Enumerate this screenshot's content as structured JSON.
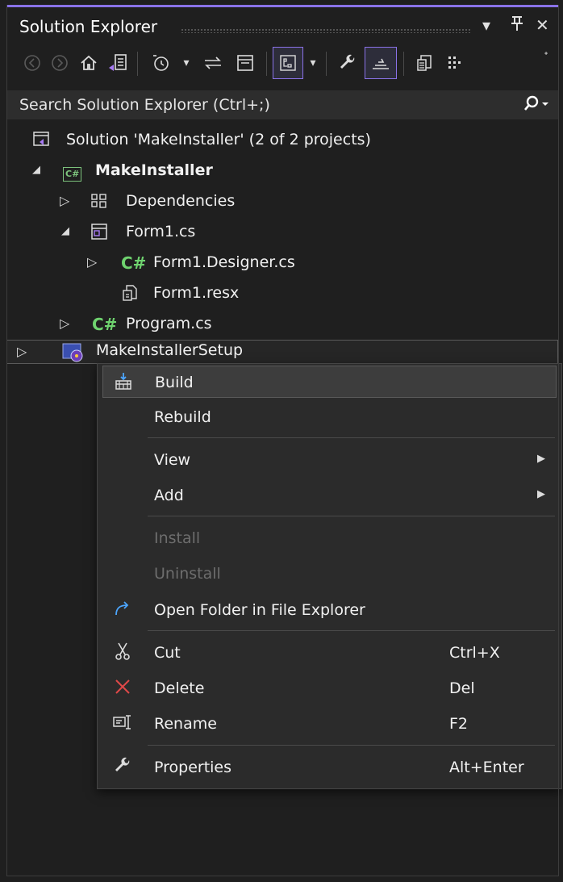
{
  "window": {
    "title": "Solution Explorer",
    "dropdown_glyph": "▾",
    "pin_glyph": "⊥",
    "close_glyph": "✕"
  },
  "toolbar": {
    "more_glyph": "ᐩ"
  },
  "search": {
    "placeholder": "Search Solution Explorer (Ctrl+;)",
    "icon_glyph": "⚲ ▾"
  },
  "tree": {
    "solution": "Solution 'MakeInstaller' (2 of 2 projects)",
    "project": "MakeInstaller",
    "project_icon_text": "C#",
    "dependencies": "Dependencies",
    "form1": "Form1.cs",
    "form1_designer": "Form1.Designer.cs",
    "form1_resx": "Form1.resx",
    "program": "Program.cs",
    "cs_prefix": "C#",
    "setup_project": "MakeInstallerSetup"
  },
  "context_menu": {
    "build": "Build",
    "rebuild": "Rebuild",
    "view": "View",
    "add": "Add",
    "install": "Install",
    "uninstall": "Uninstall",
    "open_folder": "Open Folder in File Explorer",
    "cut": "Cut",
    "cut_shortcut": "Ctrl+X",
    "delete": "Delete",
    "delete_shortcut": "Del",
    "rename": "Rename",
    "rename_shortcut": "F2",
    "properties": "Properties",
    "properties_shortcut": "Alt+Enter",
    "submenu_glyph": "▶"
  },
  "colors": {
    "accent": "#8a72e8",
    "background": "#1f1f1f",
    "menu_background": "#2b2b2b",
    "csharp_green": "#6fd36f",
    "delete_red": "#e04848",
    "open_folder_blue": "#4ca6ff"
  }
}
